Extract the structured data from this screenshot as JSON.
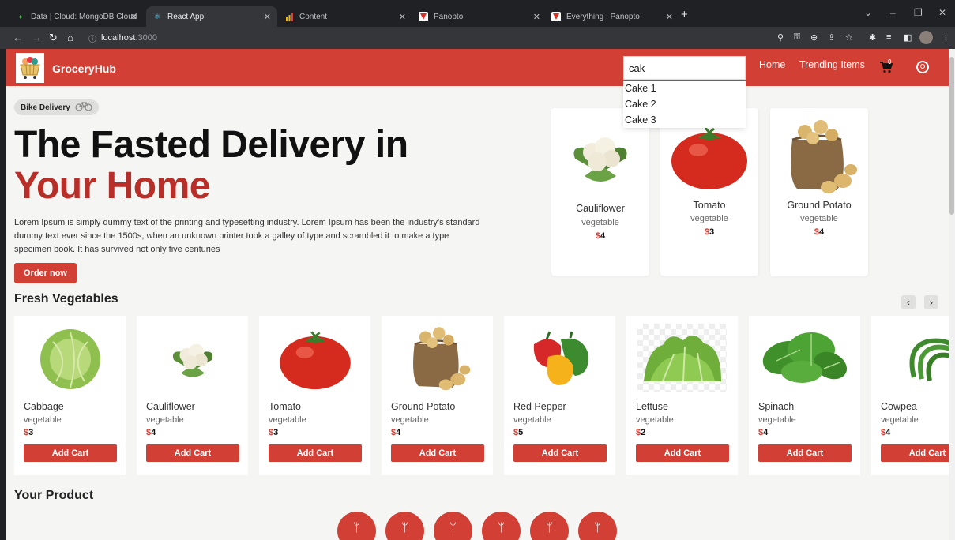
{
  "browser": {
    "tabs": [
      {
        "title": "Data | Cloud: MongoDB Cloud",
        "icon": "mongodb-leaf-icon",
        "active": false
      },
      {
        "title": "React App",
        "icon": "react-atom-icon",
        "active": true
      },
      {
        "title": "Content",
        "icon": "bar-chart-icon",
        "active": false
      },
      {
        "title": "Panopto",
        "icon": "panopto-icon",
        "active": false
      },
      {
        "title": "Everything : Panopto",
        "icon": "panopto-icon",
        "active": false
      }
    ],
    "address": {
      "host": "localhost",
      "port": ":3000"
    }
  },
  "header": {
    "brand": "GroceryHub",
    "search_value": "cak",
    "suggestions": [
      "Cake 1",
      "Cake 2",
      "Cake 3"
    ],
    "nav": {
      "home": "Home",
      "trending": "Trending Items"
    },
    "cart_count": "0",
    "colors": {
      "accent": "#d13f35",
      "accent_dark": "#b72f28"
    }
  },
  "hero": {
    "badge": "Bike Delivery",
    "title_line1": "The Fasted Delivery in",
    "title_line2": "Your Home",
    "description": "Lorem Ipsum is simply dummy text of the printing and typesetting industry. Lorem Ipsum has been the industry's standard dummy text ever since the 1500s, when an unknown printer took a galley of type and scrambled it to make a type specimen book. It has survived not only five centuries",
    "order_button": "Order now",
    "cards": [
      {
        "name": "Cauliflower",
        "category": "vegetable",
        "currency": "$",
        "price": "4"
      },
      {
        "name": "Tomato",
        "category": "vegetable",
        "currency": "$",
        "price": "3"
      },
      {
        "name": "Ground Potato",
        "category": "vegetable",
        "currency": "$",
        "price": "4"
      }
    ]
  },
  "fresh": {
    "title": "Fresh Vegetables",
    "add_label": "Add Cart",
    "items": [
      {
        "name": "Cabbage",
        "category": "vegetable",
        "currency": "$",
        "price": "3"
      },
      {
        "name": "Cauliflower",
        "category": "vegetable",
        "currency": "$",
        "price": "4"
      },
      {
        "name": "Tomato",
        "category": "vegetable",
        "currency": "$",
        "price": "3"
      },
      {
        "name": "Ground Potato",
        "category": "vegetable",
        "currency": "$",
        "price": "4"
      },
      {
        "name": "Red Pepper",
        "category": "vegetable",
        "currency": "$",
        "price": "5"
      },
      {
        "name": "Lettuse",
        "category": "vegetable",
        "currency": "$",
        "price": "2"
      },
      {
        "name": "Spinach",
        "category": "vegetable",
        "currency": "$",
        "price": "4"
      },
      {
        "name": "Cowpea",
        "category": "vegetable",
        "currency": "$",
        "price": "4"
      }
    ]
  },
  "your_product": {
    "title": "Your Product",
    "category_icons": [
      "fork-knife-icon",
      "fork-knife-icon",
      "fork-knife-icon",
      "fork-knife-icon",
      "fork-knife-icon",
      "fork-knife-icon"
    ]
  }
}
